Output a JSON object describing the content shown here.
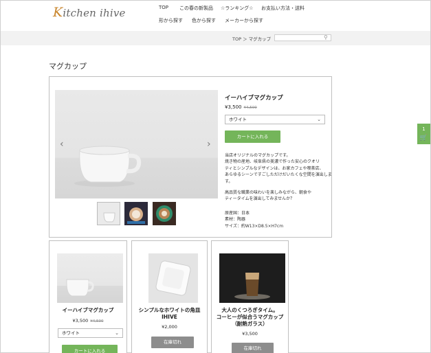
{
  "header": {
    "logo_first": "K",
    "logo_rest": "itchen ihive",
    "nav": [
      "TOP",
      "この春の新製品",
      "☆ランキング☆",
      "お支払い方法・送料",
      "形から探す",
      "色から探す",
      "メーカーから探す"
    ]
  },
  "subbar": {
    "breadcrumb": "TOP ＞ マグカップ",
    "search_placeholder": ""
  },
  "page_title": "マグカップ",
  "product": {
    "name": "イーハイブマグカップ",
    "price": "¥3,500",
    "old_price": "¥4,500",
    "color_selected": "ホワイト",
    "add_to_cart": "カートに入れる",
    "description_lines": [
      "当店オリジナルのマグカップです。",
      "焼き物の産地、岐阜県の美濃で作った安心のクオリ",
      "ティとシンプルなデザインは、お家カフェや喫茶店、",
      "あらゆるシーンですごしただけだいたくな空間を演出しま",
      "す。"
    ],
    "description2_lines": [
      "高品質な職業の味わいを楽しみながら、朝食や",
      "ティータイムを演出してみませんか？"
    ],
    "spec_lines": [
      "原産国：日本",
      "素材：陶器",
      "サイズ：約W13×D8.5×H7cm"
    ]
  },
  "cards": [
    {
      "title_lines": [
        "イーハイブマグカップ"
      ],
      "price": "¥3,500",
      "old_price": "¥4,500",
      "select": "ホワイト",
      "button": "カートに入れる"
    },
    {
      "title_lines": [
        "シンプルなホワイトの角皿",
        "IHIVE"
      ],
      "price": "¥2,000",
      "button": "在庫切れ"
    },
    {
      "title_lines": [
        "大人のくつろぎタイム。",
        "コーヒーが似合うマグカップ",
        "（耐熱ガラス）"
      ],
      "price": "¥3,500",
      "button": "在庫切れ"
    }
  ],
  "cart": {
    "count": "1",
    "icon": "cart-icon"
  },
  "colors": {
    "accent_green": "#74b55a",
    "sold_out_gray": "#8d8d8d",
    "logo_orange": "#c9862d"
  }
}
